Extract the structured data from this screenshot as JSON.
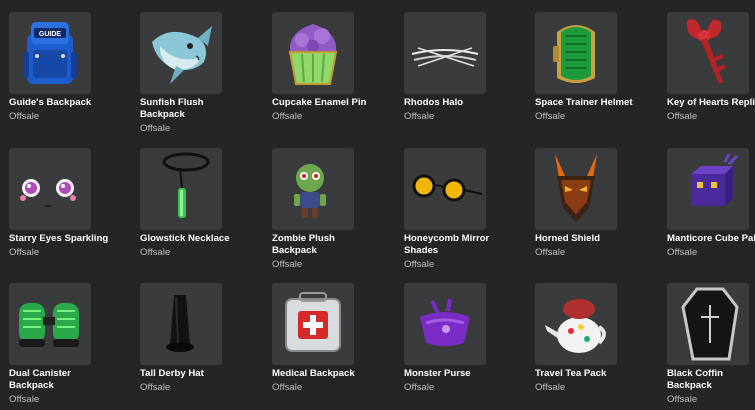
{
  "items": [
    {
      "name": "Guide's Backpack",
      "price": "Offsale",
      "icon": "backpack-icon"
    },
    {
      "name": "Sunfish Flush Backpack",
      "price": "Offsale",
      "icon": "fish-icon"
    },
    {
      "name": "Cupcake Enamel Pin",
      "price": "Offsale",
      "icon": "cupcake-icon"
    },
    {
      "name": "Rhodos Halo",
      "price": "Offsale",
      "icon": "halo-icon"
    },
    {
      "name": "Space Trainer Helmet",
      "price": "Offsale",
      "icon": "helmet-icon"
    },
    {
      "name": "Key of Hearts Replica",
      "price": "Offsale",
      "icon": "key-icon"
    },
    {
      "name": "Starry Eyes Sparkling",
      "price": "Offsale",
      "icon": "eyes-icon"
    },
    {
      "name": "Glowstick Necklace",
      "price": "Offsale",
      "icon": "necklace-icon"
    },
    {
      "name": "Zombie Plush Backpack",
      "price": "Offsale",
      "icon": "zombie-icon"
    },
    {
      "name": "Honeycomb Mirror Shades",
      "price": "Offsale",
      "icon": "sunglasses-icon"
    },
    {
      "name": "Horned Shield",
      "price": "Offsale",
      "icon": "horned-mask-icon"
    },
    {
      "name": "Manticore Cube Pal",
      "price": "Offsale",
      "icon": "cube-pal-icon"
    },
    {
      "name": "Dual Canister Backpack",
      "price": "Offsale",
      "icon": "canister-icon"
    },
    {
      "name": "Tall Derby Hat",
      "price": "Offsale",
      "icon": "hat-icon"
    },
    {
      "name": "Medical Backpack",
      "price": "Offsale",
      "icon": "medical-kit-icon"
    },
    {
      "name": "Monster Purse",
      "price": "Offsale",
      "icon": "purse-icon"
    },
    {
      "name": "Travel Tea Pack",
      "price": "Offsale",
      "icon": "teapot-icon"
    },
    {
      "name": "Black Coffin Backpack",
      "price": "Offsale",
      "icon": "coffin-icon"
    }
  ]
}
